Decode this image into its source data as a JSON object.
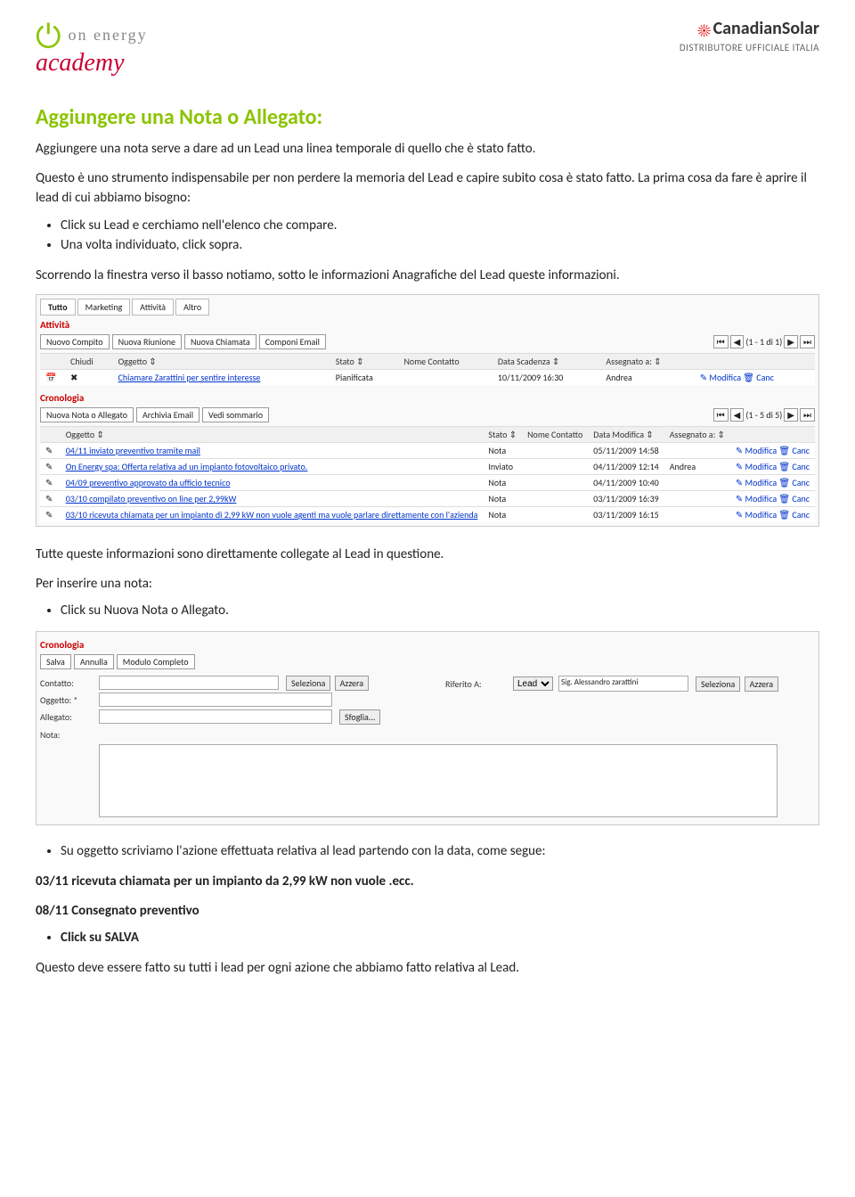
{
  "header": {
    "left_top": "on energy",
    "left_bottom": "academy",
    "right_name": "CanadianSolar",
    "right_sub": "DISTRIBUTORE UFFICIALE ITALIA"
  },
  "title": "Aggiungere una Nota o Allegato:",
  "p1": "Aggiungere una nota serve a dare ad un Lead una linea temporale di quello che è stato fatto.",
  "p2": "Questo è uno strumento indispensabile per non perdere la memoria del Lead e capire subito cosa è stato fatto. La prima cosa da fare è aprire il lead di cui abbiamo bisogno:",
  "bullets1": [
    "Click su Lead e cerchiamo nell'elenco che compare.",
    "Una volta individuato, click sopra."
  ],
  "p3": "Scorrendo la finestra verso il basso notiamo, sotto le informazioni Anagrafiche del Lead queste informazioni.",
  "crm1": {
    "tabs": [
      "Tutto",
      "Marketing",
      "Attività",
      "Altro"
    ],
    "sect_att": "Attività",
    "toolbar1": [
      "Nuovo Compito",
      "Nuova Riunione",
      "Nuova Chiamata",
      "Componi Email"
    ],
    "pager1": "(1 - 1 di 1)",
    "th1": [
      "Chiudi",
      "Oggetto ⇕",
      "Stato ⇕",
      "Nome Contatto",
      "Data Scadenza ⇕",
      "Assegnato a: ⇕",
      ""
    ],
    "row1": {
      "oggetto": "Chiamare Zarattini per sentire interesse",
      "stato": "Pianificata",
      "contatto": "",
      "data": "10/11/2009 16:30",
      "asseg": "Andrea",
      "mod": "Modifica",
      "canc": "Canc"
    },
    "sect_cron": "Cronologia",
    "toolbar2": [
      "Nuova Nota o Allegato",
      "Archivia Email",
      "Vedi sommario"
    ],
    "pager2": "(1 - 5 di 5)",
    "th2": [
      "",
      "Oggetto ⇕",
      "Stato ⇕",
      "Nome Contatto",
      "Data Modifica ⇕",
      "Assegnato a: ⇕",
      ""
    ],
    "rows2": [
      {
        "oggetto": "04/11 inviato preventivo tramite mail",
        "stato": "Nota",
        "contatto": "",
        "data": "05/11/2009 14:58",
        "asseg": "",
        "mod": "Modifica",
        "canc": "Canc"
      },
      {
        "oggetto": "On Energy spa: Offerta relativa ad un impianto fotovoltaico privato.",
        "stato": "Inviato",
        "contatto": "",
        "data": "04/11/2009 12:14",
        "asseg": "Andrea",
        "mod": "Modifica",
        "canc": "Canc"
      },
      {
        "oggetto": "04/09 preventivo approvato da ufficio tecnico",
        "stato": "Nota",
        "contatto": "",
        "data": "04/11/2009 10:40",
        "asseg": "",
        "mod": "Modifica",
        "canc": "Canc"
      },
      {
        "oggetto": "03/10 compilato preventivo on line per 2,99kW",
        "stato": "Nota",
        "contatto": "",
        "data": "03/11/2009 16:39",
        "asseg": "",
        "mod": "Modifica",
        "canc": "Canc"
      },
      {
        "oggetto": "03/10 ricevuta chiamata per un impianto di 2,99 kW non vuole agenti ma vuole parlare direttamente con l'azienda",
        "stato": "Nota",
        "contatto": "",
        "data": "03/11/2009 16:15",
        "asseg": "",
        "mod": "Modifica",
        "canc": "Canc"
      }
    ]
  },
  "p4": "Tutte queste informazioni sono direttamente collegate al Lead in questione.",
  "p5": "Per inserire una nota:",
  "bullets2": [
    "Click su Nuova Nota o Allegato."
  ],
  "crm2": {
    "sect": "Cronologia",
    "toolbar": [
      "Salva",
      "Annulla",
      "Modulo Completo"
    ],
    "fields": {
      "contatto": "Contatto:",
      "oggetto": "Oggetto: *",
      "allegato": "Allegato:",
      "nota": "Nota:",
      "riferito": "Riferito A:",
      "seleziona": "Seleziona",
      "azzera": "Azzera",
      "sfoglia": "Sfoglia...",
      "lead_sel": "Lead",
      "lead_name": "Sig. Alessandro zarattini"
    }
  },
  "bullets3": [
    "Su oggetto scriviamo l'azione effettuata relativa al lead partendo con la data, come segue:"
  ],
  "p6": "03/11 ricevuta chiamata per un impianto da 2,99 kW non vuole .ecc.",
  "p7": "08/11 Consegnato preventivo",
  "bullets4": [
    "Click su SALVA"
  ],
  "p8": "Questo deve essere fatto su tutti i lead per ogni azione che abbiamo fatto relativa al Lead."
}
